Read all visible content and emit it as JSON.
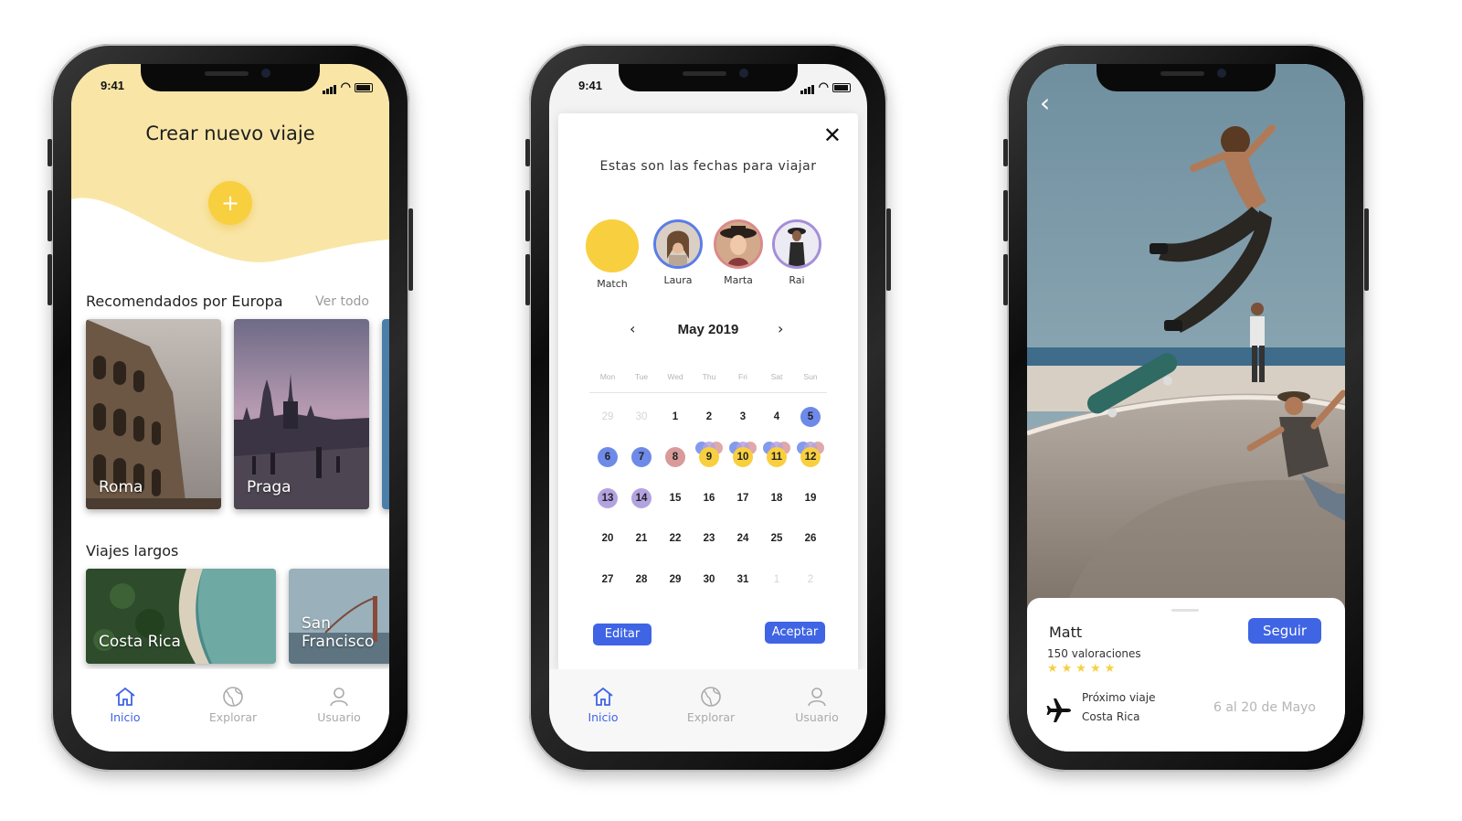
{
  "status": {
    "time": "9:41"
  },
  "screen1": {
    "title": "Crear nuevo viaje",
    "fab_symbol": "+",
    "section1": {
      "title": "Recomendados por Europa",
      "link": "Ver todo",
      "cards": [
        {
          "label": "Roma"
        },
        {
          "label": "Praga"
        }
      ]
    },
    "section2": {
      "title": "Viajes largos",
      "cards": [
        {
          "label": "Costa Rica"
        },
        {
          "label": "San Francisco"
        }
      ]
    }
  },
  "screen2": {
    "close_symbol": "✕",
    "heading": "Estas son las fechas para viajar",
    "people": [
      {
        "name": "Match"
      },
      {
        "name": "Laura"
      },
      {
        "name": "Marta"
      },
      {
        "name": "Rai"
      }
    ],
    "calendar": {
      "month": "May 2019",
      "prev_symbol": "‹",
      "next_symbol": "›",
      "weekdays": [
        "Mon",
        "Tue",
        "Wed",
        "Thu",
        "Fri",
        "Sat",
        "Sun"
      ],
      "weeks": [
        [
          "29",
          "30",
          "1",
          "2",
          "3",
          "4",
          "5"
        ],
        [
          "6",
          "7",
          "8",
          "9",
          "10",
          "11",
          "12"
        ],
        [
          "13",
          "14",
          "15",
          "16",
          "17",
          "18",
          "19"
        ],
        [
          "20",
          "21",
          "22",
          "23",
          "24",
          "25",
          "26"
        ],
        [
          "27",
          "28",
          "29",
          "30",
          "31",
          "1",
          "2"
        ]
      ]
    },
    "edit_label": "Editar",
    "accept_label": "Aceptar"
  },
  "tabbar": {
    "tabs": [
      {
        "label": "Inicio"
      },
      {
        "label": "Explorar"
      },
      {
        "label": "Usuario"
      }
    ]
  },
  "screen3": {
    "back_symbol": "‹",
    "user": "Matt",
    "follow_label": "Seguir",
    "ratings": "150 valoraciones",
    "stars": 5,
    "next_trip_label": "Próximo viaje",
    "next_trip_place": "Costa Rica",
    "next_trip_dates": "6 al 20 de Mayo"
  },
  "colors": {
    "accent": "#3f64e4",
    "yellow": "#f8cf3f",
    "header_yellow": "#f9e6a7",
    "marta": "#d98a8a",
    "rai": "#a48ed8"
  }
}
